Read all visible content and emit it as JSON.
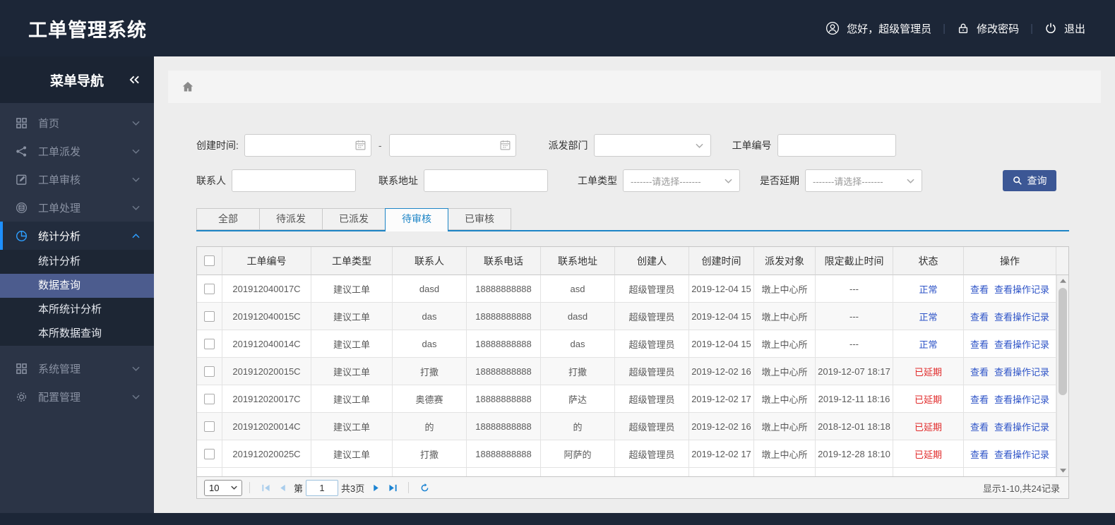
{
  "app_title": "工单管理系统",
  "header": {
    "greeting": "您好，超级管理员",
    "change_password": "修改密码",
    "logout": "退出"
  },
  "sidebar": {
    "title": "菜单导航",
    "items": [
      {
        "label": "首页",
        "icon": "grid-icon"
      },
      {
        "label": "工单派发",
        "icon": "share-icon"
      },
      {
        "label": "工单审核",
        "icon": "edit-icon"
      },
      {
        "label": "工单处理",
        "icon": "layers-icon"
      },
      {
        "label": "统计分析",
        "icon": "pie-icon",
        "active": true,
        "submenu": [
          {
            "label": "统计分析"
          },
          {
            "label": "数据查询",
            "selected": true
          },
          {
            "label": "本所统计分析"
          },
          {
            "label": "本所数据查询"
          }
        ]
      },
      {
        "label": "系统管理",
        "icon": "grid-icon"
      },
      {
        "label": "配置管理",
        "icon": "gear-icon"
      }
    ]
  },
  "filters": {
    "created_time": {
      "label": "创建时间:",
      "start_value": "",
      "end_value": "",
      "separator": "-"
    },
    "dispatch_dept": {
      "label": "派发部门",
      "value": ""
    },
    "order_no": {
      "label": "工单编号",
      "value": ""
    },
    "contact": {
      "label": "联系人",
      "value": ""
    },
    "address": {
      "label": "联系地址",
      "value": ""
    },
    "order_type": {
      "label": "工单类型",
      "value": "-------请选择-------"
    },
    "is_delayed": {
      "label": "是否延期",
      "value": "-------请选择-------"
    },
    "search_button": "查询"
  },
  "tabs": [
    {
      "label": "全部"
    },
    {
      "label": "待派发"
    },
    {
      "label": "已派发"
    },
    {
      "label": "待审核",
      "active": true
    },
    {
      "label": "已审核"
    }
  ],
  "table": {
    "columns": [
      "工单编号",
      "工单类型",
      "联系人",
      "联系电话",
      "联系地址",
      "创建人",
      "创建时间",
      "派发对象",
      "限定截止时间",
      "状态",
      "操作"
    ],
    "action_labels": [
      "查看",
      "查看操作记录"
    ],
    "rows": [
      {
        "order_no": "201912040017C",
        "order_type": "建议工单",
        "contact": "dasd",
        "phone": "18888888888",
        "address": "asd",
        "creator": "超级管理员",
        "created_at": "2019-12-04 15",
        "dispatch_target": "墩上中心所",
        "deadline": "---",
        "status": "正常",
        "status_type": "normal"
      },
      {
        "order_no": "201912040015C",
        "order_type": "建议工单",
        "contact": "das",
        "phone": "18888888888",
        "address": "dasd",
        "creator": "超级管理员",
        "created_at": "2019-12-04 15",
        "dispatch_target": "墩上中心所",
        "deadline": "---",
        "status": "正常",
        "status_type": "normal"
      },
      {
        "order_no": "201912040014C",
        "order_type": "建议工单",
        "contact": "das",
        "phone": "18888888888",
        "address": "das",
        "creator": "超级管理员",
        "created_at": "2019-12-04 15",
        "dispatch_target": "墩上中心所",
        "deadline": "---",
        "status": "正常",
        "status_type": "normal"
      },
      {
        "order_no": "201912020015C",
        "order_type": "建议工单",
        "contact": "打撒",
        "phone": "18888888888",
        "address": "打撒",
        "creator": "超级管理员",
        "created_at": "2019-12-02 16",
        "dispatch_target": "墩上中心所",
        "deadline": "2019-12-07 18:17",
        "status": "已延期",
        "status_type": "delayed"
      },
      {
        "order_no": "201912020017C",
        "order_type": "建议工单",
        "contact": "奥德赛",
        "phone": "18888888888",
        "address": "萨达",
        "creator": "超级管理员",
        "created_at": "2019-12-02 17",
        "dispatch_target": "墩上中心所",
        "deadline": "2019-12-11 18:16",
        "status": "已延期",
        "status_type": "delayed"
      },
      {
        "order_no": "201912020014C",
        "order_type": "建议工单",
        "contact": "的",
        "phone": "18888888888",
        "address": "的",
        "creator": "超级管理员",
        "created_at": "2019-12-02 16",
        "dispatch_target": "墩上中心所",
        "deadline": "2018-12-01 18:18",
        "status": "已延期",
        "status_type": "delayed"
      },
      {
        "order_no": "201912020025C",
        "order_type": "建议工单",
        "contact": "打撒",
        "phone": "18888888888",
        "address": "阿萨的",
        "creator": "超级管理员",
        "created_at": "2019-12-02 17",
        "dispatch_target": "墩上中心所",
        "deadline": "2019-12-28 18:10",
        "status": "已延期",
        "status_type": "delayed"
      }
    ]
  },
  "pagination": {
    "page_size": "10",
    "page_prefix": "第",
    "current_page": "1",
    "total_pages": "共3页",
    "summary": "显示1-10,共24记录"
  },
  "colors": {
    "header_dark": "#1c2637",
    "sidebar_bg": "#2b3446",
    "accent_blue": "#1d85c6",
    "link_blue": "#2d53c7",
    "status_delayed_red": "#e12a2a",
    "search_button_blue": "#3c5795",
    "selected_menu_bg": "#4c5c8e"
  }
}
